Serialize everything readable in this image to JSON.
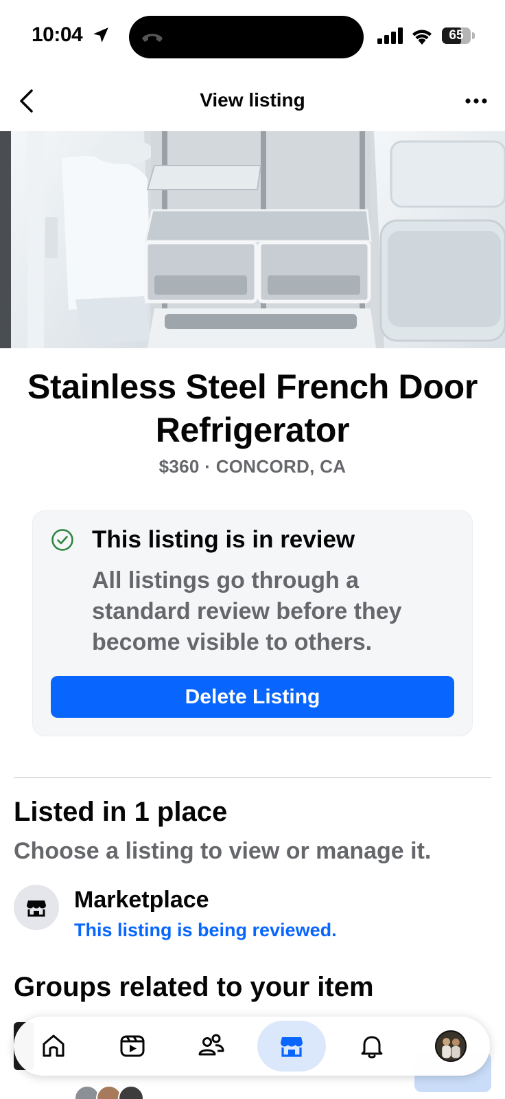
{
  "status_bar": {
    "time": "10:04",
    "battery": "65"
  },
  "header": {
    "title": "View listing"
  },
  "listing": {
    "title": "Stainless Steel French Door Refrigerator",
    "price_location": "$360 · CONCORD, CA"
  },
  "review_card": {
    "heading": "This listing is in review",
    "body": "All listings go through a standard review before they become visible to others.",
    "delete_label": "Delete Listing"
  },
  "listed": {
    "title": "Listed in 1 place",
    "subtitle": "Choose a listing to view or manage it.",
    "marketplace": {
      "name": "Marketplace",
      "status": "This listing is being reviewed."
    }
  },
  "groups": {
    "title": "Groups related to your item"
  },
  "tabbar": {
    "tabs": [
      {
        "icon": "home-icon"
      },
      {
        "icon": "video-icon"
      },
      {
        "icon": "friends-icon"
      },
      {
        "icon": "marketplace-icon",
        "active": true
      },
      {
        "icon": "bell-icon"
      },
      {
        "icon": "profile-avatar"
      }
    ]
  },
  "colors": {
    "accent": "#0866ff",
    "secondary_text": "#65676b",
    "check_green": "#2e8540"
  }
}
